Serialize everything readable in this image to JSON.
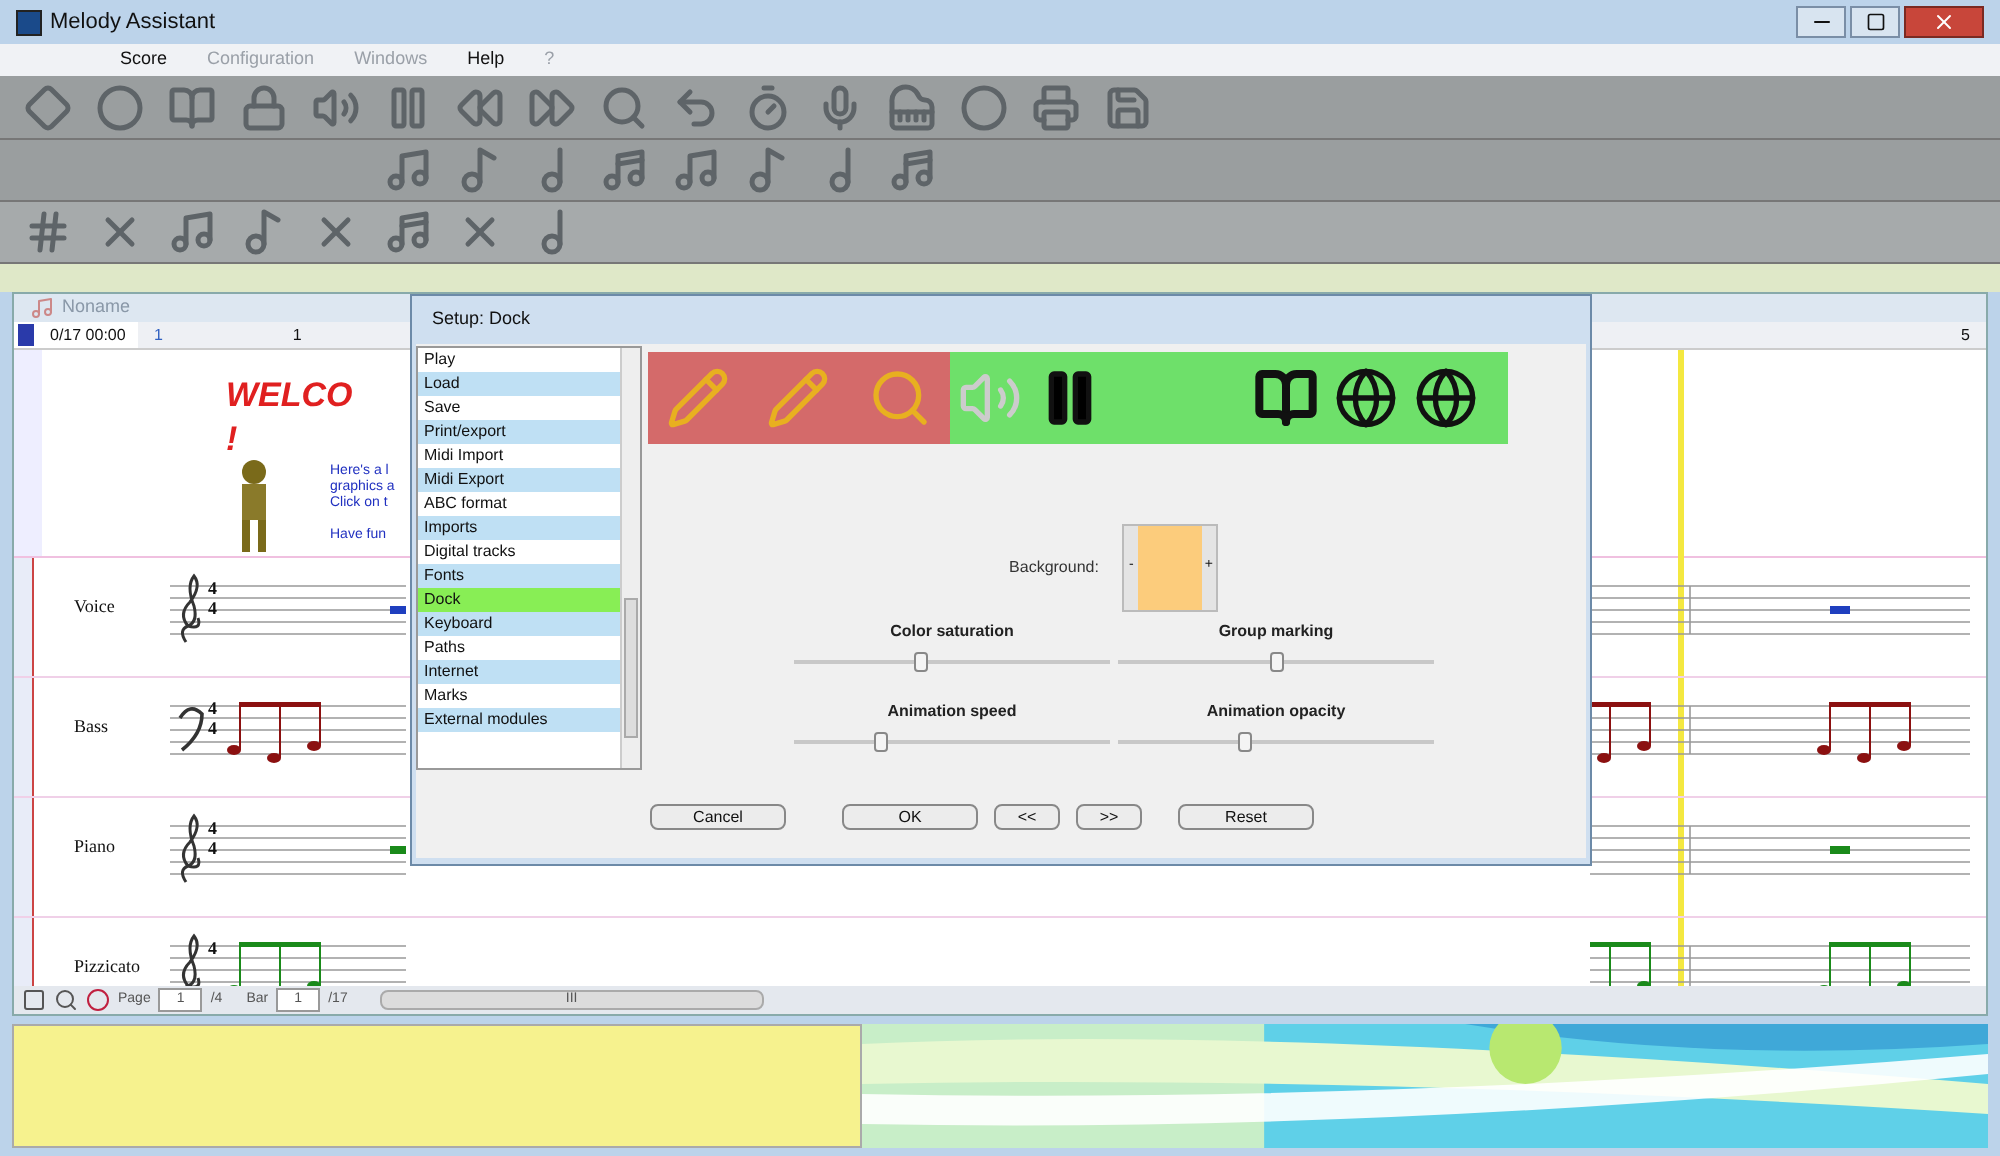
{
  "window": {
    "title": "Melody Assistant"
  },
  "menu": [
    {
      "label": "Score",
      "disabled": false
    },
    {
      "label": "Configuration",
      "disabled": true
    },
    {
      "label": "Windows",
      "disabled": true
    },
    {
      "label": "Help",
      "disabled": false
    },
    {
      "label": "?",
      "disabled": true
    }
  ],
  "score_window": {
    "title": "Noname",
    "position": "0/17 00:00",
    "bar_marker": "1",
    "ruler_labels": [
      "1",
      "5"
    ],
    "welcome": {
      "title": "WELCO",
      "exclaim": "!",
      "lines": [
        "Here's a l",
        "graphics a",
        "Click on t"
      ],
      "footer": "Have fun"
    },
    "tracks": [
      {
        "name": "Voice",
        "kind": "treble",
        "time": [
          "4",
          "4"
        ],
        "color": "#1f3fbf",
        "beamed": false
      },
      {
        "name": "Bass",
        "kind": "bass",
        "time": [
          "4",
          "4"
        ],
        "color": "#8b1010",
        "beamed": true
      },
      {
        "name": "Piano",
        "kind": "treble",
        "time": [
          "4",
          "4"
        ],
        "color": "#1a8a1a",
        "beamed": false
      },
      {
        "name": "Pizzicato",
        "kind": "treble",
        "time": [
          "4"
        ],
        "color": "#1a8a1a",
        "beamed": true
      }
    ],
    "status": {
      "page_label": "Page",
      "page": "1",
      "page_total": "/4",
      "bar_label": "Bar",
      "bar": "1",
      "bar_total": "/17",
      "scroll_grip": "III"
    }
  },
  "dialog": {
    "title": "Setup: Dock",
    "items": [
      {
        "label": "Play",
        "selected": false
      },
      {
        "label": "Load",
        "selected": false
      },
      {
        "label": "Save",
        "selected": false
      },
      {
        "label": "Print/export",
        "selected": false
      },
      {
        "label": "Midi Import",
        "selected": false
      },
      {
        "label": "Midi Export",
        "selected": false
      },
      {
        "label": "ABC format",
        "selected": false
      },
      {
        "label": "Imports",
        "selected": false
      },
      {
        "label": "Digital tracks",
        "selected": false
      },
      {
        "label": "Fonts",
        "selected": false
      },
      {
        "label": "Dock",
        "selected": true
      },
      {
        "label": "Keyboard",
        "selected": false
      },
      {
        "label": "Paths",
        "selected": false
      },
      {
        "label": "Internet",
        "selected": false
      },
      {
        "label": "Marks",
        "selected": false
      },
      {
        "label": "External modules",
        "selected": false
      }
    ],
    "background_label": "Background:",
    "minus": "-",
    "plus": "+",
    "sliders": [
      {
        "label": "Color saturation",
        "level": 0.4
      },
      {
        "label": "Group marking",
        "level": 0.5
      },
      {
        "label": "Animation speed",
        "level": 0.27
      },
      {
        "label": "Animation opacity",
        "level": 0.4
      }
    ],
    "buttons": [
      "Cancel",
      "OK",
      "<<",
      ">>",
      "Reset"
    ]
  }
}
